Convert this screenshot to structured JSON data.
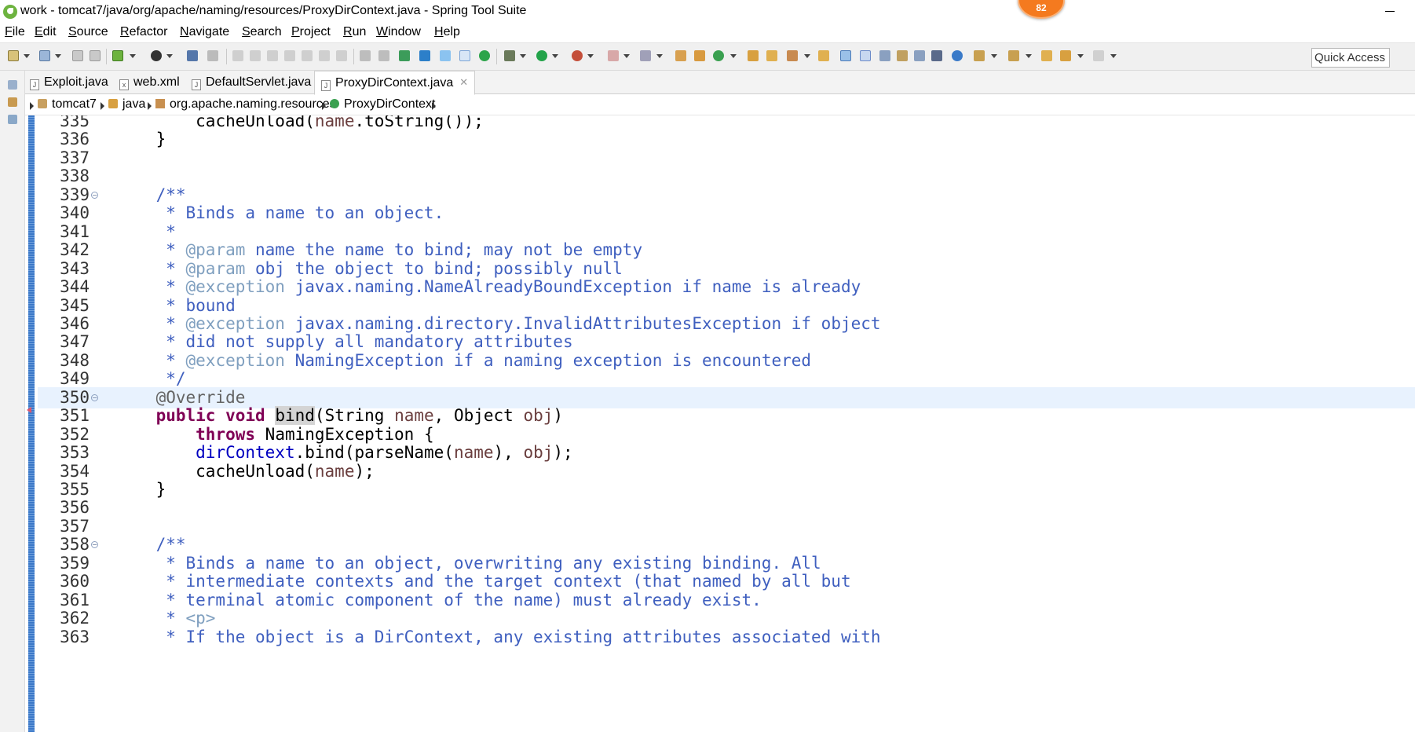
{
  "window": {
    "title": "work - tomcat7/java/org/apache/naming/resources/ProxyDirContext.java - Spring Tool Suite",
    "badge_count": "82"
  },
  "menu": [
    {
      "label": "File"
    },
    {
      "label": "Edit"
    },
    {
      "label": "Source"
    },
    {
      "label": "Refactor"
    },
    {
      "label": "Navigate"
    },
    {
      "label": "Search"
    },
    {
      "label": "Project"
    },
    {
      "label": "Run"
    },
    {
      "label": "Window"
    },
    {
      "label": "Help"
    }
  ],
  "toolbar": {
    "quick_access": "Quick Access"
  },
  "tabs": [
    {
      "label": "Exploit.java",
      "icon": "java-file-icon"
    },
    {
      "label": "web.xml",
      "icon": "xml-file-icon"
    },
    {
      "label": "DefaultServlet.java",
      "icon": "java-file-icon"
    },
    {
      "label": "ProxyDirContext.java",
      "icon": "java-file-icon",
      "active": true
    }
  ],
  "breadcrumb": [
    "tomcat7",
    "java",
    "org.apache.naming.resources",
    "ProxyDirContext"
  ],
  "editor": {
    "lines": [
      {
        "n": "335",
        "text": "        cacheUnload(name.toString());"
      },
      {
        "n": "336",
        "text": "    }"
      },
      {
        "n": "337",
        "text": ""
      },
      {
        "n": "338",
        "text": ""
      },
      {
        "n": "339",
        "text": "    /**",
        "fold": true
      },
      {
        "n": "340",
        "text": "     * Binds a name to an object."
      },
      {
        "n": "341",
        "text": "     *"
      },
      {
        "n": "342",
        "text": "     * @param name the name to bind; may not be empty"
      },
      {
        "n": "343",
        "text": "     * @param obj the object to bind; possibly null"
      },
      {
        "n": "344",
        "text": "     * @exception javax.naming.NameAlreadyBoundException if name is already"
      },
      {
        "n": "345",
        "text": "     * bound"
      },
      {
        "n": "346",
        "text": "     * @exception javax.naming.directory.InvalidAttributesException if object"
      },
      {
        "n": "347",
        "text": "     * did not supply all mandatory attributes"
      },
      {
        "n": "348",
        "text": "     * @exception NamingException if a naming exception is encountered"
      },
      {
        "n": "349",
        "text": "     */"
      },
      {
        "n": "350",
        "text": "    @Override",
        "fold": true,
        "current": true
      },
      {
        "n": "351",
        "text": "    public void bind(String name, Object obj)"
      },
      {
        "n": "352",
        "text": "        throws NamingException {"
      },
      {
        "n": "353",
        "text": "        dirContext.bind(parseName(name), obj);"
      },
      {
        "n": "354",
        "text": "        cacheUnload(name);"
      },
      {
        "n": "355",
        "text": "    }"
      },
      {
        "n": "356",
        "text": ""
      },
      {
        "n": "357",
        "text": ""
      },
      {
        "n": "358",
        "text": "    /**",
        "fold": true
      },
      {
        "n": "359",
        "text": "     * Binds a name to an object, overwriting any existing binding. All"
      },
      {
        "n": "360",
        "text": "     * intermediate contexts and the target context (that named by all but"
      },
      {
        "n": "361",
        "text": "     * terminal atomic component of the name) must already exist."
      },
      {
        "n": "362",
        "text": "     * <p>"
      },
      {
        "n": "363",
        "text": "     * If the object is a DirContext, any existing attributes associated with"
      }
    ]
  }
}
